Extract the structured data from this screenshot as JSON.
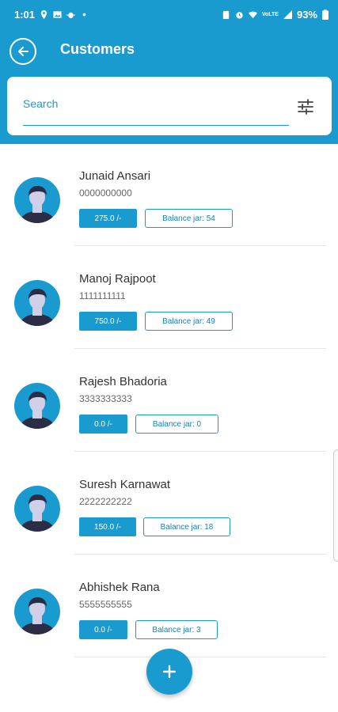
{
  "status": {
    "time": "1:01",
    "battery": "93%",
    "left_icons": [
      "location-icon",
      "image-icon",
      "bug-icon",
      "dot-icon"
    ],
    "right_icons": [
      "battery-saver-icon",
      "alarm-icon",
      "wifi-icon",
      "lte-icon",
      "signal-icon",
      "battery-icon"
    ]
  },
  "appbar": {
    "title": "Customers",
    "back_icon": "arrow-left-icon"
  },
  "search": {
    "placeholder": "Search",
    "filter_icon": "sliders-icon"
  },
  "customers": [
    {
      "name": "Junaid Ansari",
      "phone": "0000000000",
      "amount": "275.0 /-",
      "balance": "Balance jar: 54"
    },
    {
      "name": "Manoj Rajpoot",
      "phone": "1111111111",
      "amount": "750.0 /-",
      "balance": "Balance jar: 49"
    },
    {
      "name": "Rajesh Bhadoria",
      "phone": "3333333333",
      "amount": "0.0 /-",
      "balance": "Balance jar: 0"
    },
    {
      "name": "Suresh Karnawat",
      "phone": "2222222222",
      "amount": "150.0 /-",
      "balance": "Balance jar: 18"
    },
    {
      "name": "Abhishek Rana",
      "phone": "5555555555",
      "amount": "0.0 /-",
      "balance": "Balance jar: 3"
    }
  ],
  "fab": {
    "icon": "plus-icon"
  },
  "colors": {
    "primary": "#1a9bd0",
    "avatar_face": "#cfd0e8",
    "avatar_dark": "#2b2d45"
  }
}
